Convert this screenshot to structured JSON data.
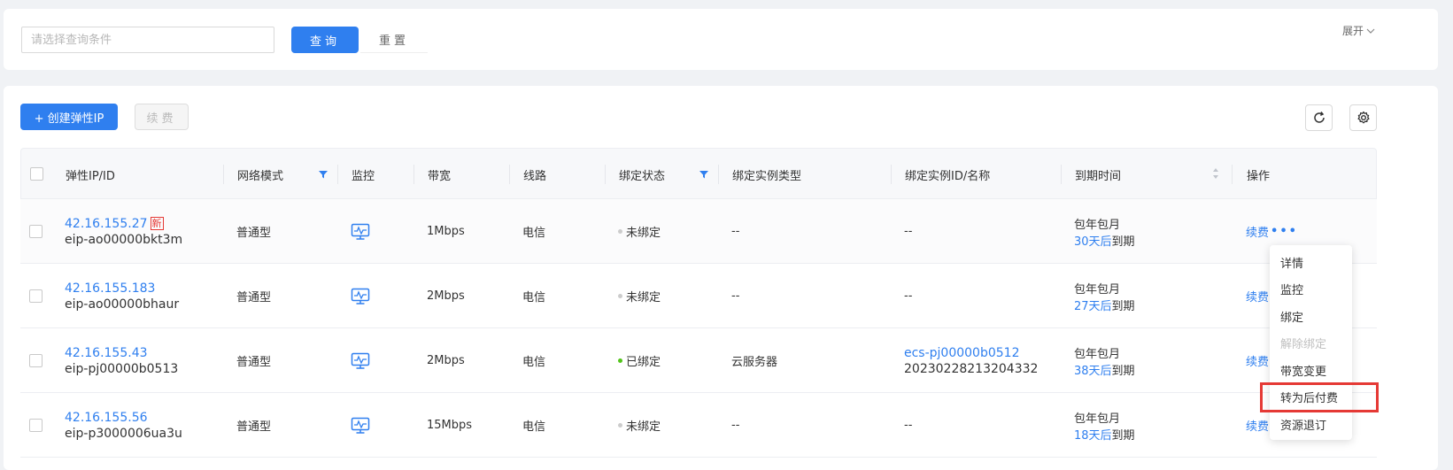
{
  "search": {
    "placeholder": "请选择查询条件",
    "query_label": "查询",
    "reset_label": "重置",
    "expand_label": "展开"
  },
  "toolbar": {
    "create_label": "+ 创建弹性IP",
    "renew_label": "续费"
  },
  "table": {
    "headers": {
      "ip": "弹性IP/ID",
      "mode": "网络模式",
      "monitor": "监控",
      "bandwidth": "带宽",
      "line": "线路",
      "bind_status": "绑定状态",
      "instance_type": "绑定实例类型",
      "instance_id": "绑定实例ID/名称",
      "expire": "到期时间",
      "ops": "操作"
    },
    "rows": [
      {
        "ip": "42.16.155.27",
        "new_tag": "新",
        "id": "eip-ao00000bkt3m",
        "mode": "普通型",
        "bandwidth": "1Mbps",
        "line": "电信",
        "status": "未绑定",
        "instance_type": "--",
        "instance_id": "--",
        "instance_name": "",
        "billing": "包年包月",
        "days": "30天后",
        "expire_suffix": "到期",
        "op": "续费",
        "more": "•••"
      },
      {
        "ip": "42.16.155.183",
        "new_tag": "",
        "id": "eip-ao00000bhaur",
        "mode": "普通型",
        "bandwidth": "2Mbps",
        "line": "电信",
        "status": "未绑定",
        "instance_type": "--",
        "instance_id": "--",
        "instance_name": "",
        "billing": "包年包月",
        "days": "27天后",
        "expire_suffix": "到期",
        "op": "续费",
        "more": ""
      },
      {
        "ip": "42.16.155.43",
        "new_tag": "",
        "id": "eip-pj00000b0513",
        "mode": "普通型",
        "bandwidth": "2Mbps",
        "line": "电信",
        "status": "已绑定",
        "instance_type": "云服务器",
        "instance_id": "ecs-pj00000b0512",
        "instance_name": "20230228213204332",
        "billing": "包年包月",
        "days": "38天后",
        "expire_suffix": "到期",
        "op": "续费",
        "more": ""
      },
      {
        "ip": "42.16.155.56",
        "new_tag": "",
        "id": "eip-p3000006ua3u",
        "mode": "普通型",
        "bandwidth": "15Mbps",
        "line": "电信",
        "status": "未绑定",
        "instance_type": "--",
        "instance_id": "--",
        "instance_name": "",
        "billing": "包年包月",
        "days": "18天后",
        "expire_suffix": "到期",
        "op": "续费",
        "more": ""
      }
    ]
  },
  "dropdown": {
    "items": [
      {
        "label": "详情"
      },
      {
        "label": "监控"
      },
      {
        "label": "绑定"
      },
      {
        "label": "解除绑定"
      },
      {
        "label": "带宽变更"
      },
      {
        "label": "转为后付费"
      },
      {
        "label": "资源退订"
      }
    ]
  },
  "colors": {
    "primary": "#2f7fef",
    "bound": "#52c41a",
    "highlight": "#e53935"
  }
}
